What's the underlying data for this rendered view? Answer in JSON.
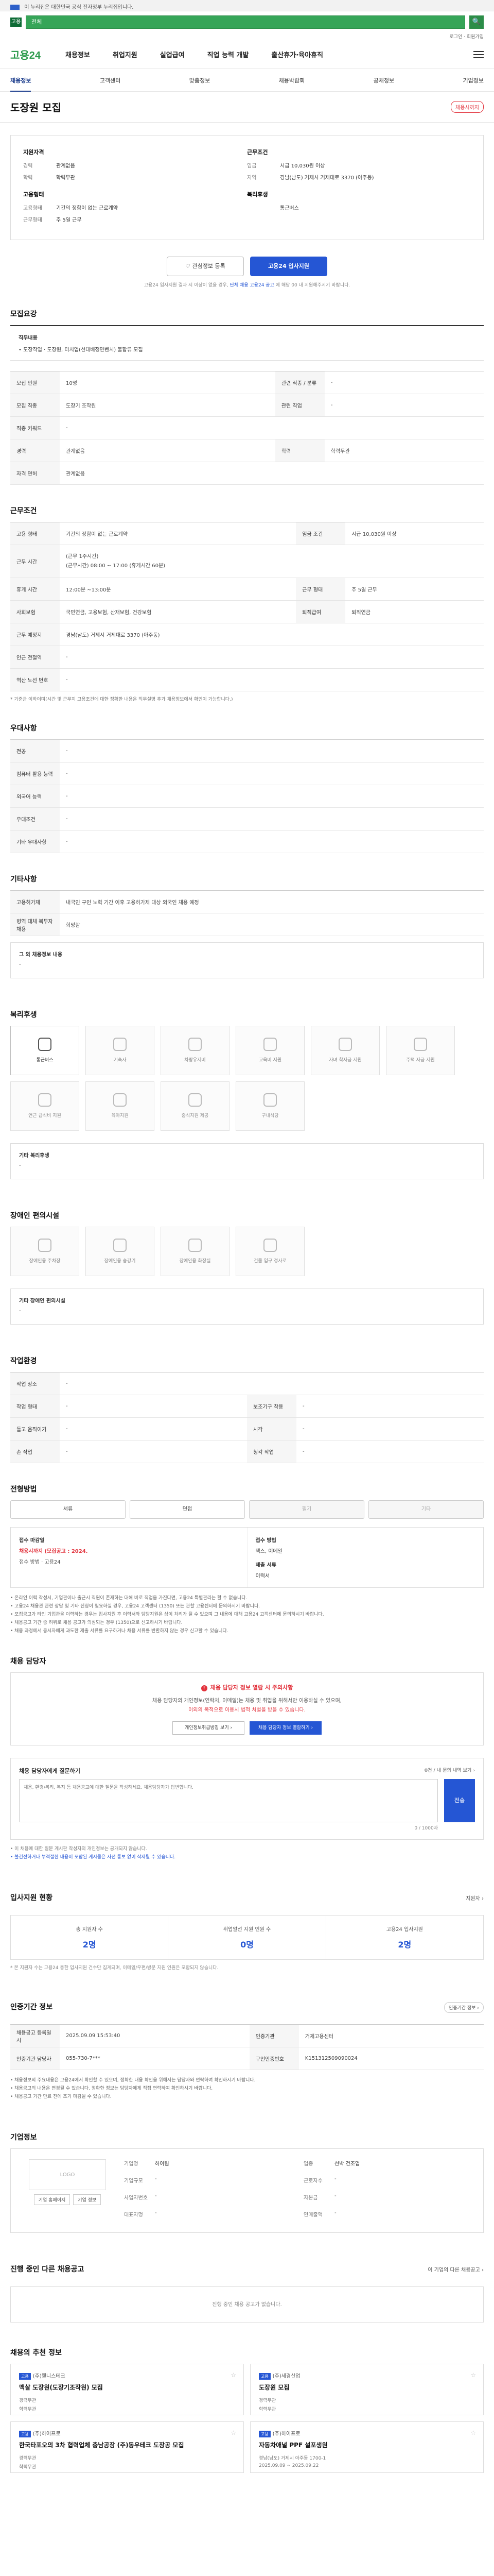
{
  "gov_bar": {
    "text": "이 누리집은 대한민국 공식 전자정부 누리집입니다."
  },
  "search": {
    "badge": "고용",
    "value": "전체",
    "button": "🔍"
  },
  "util_links": "로그인 · 회원가입",
  "header": {
    "logo": "고용24",
    "nav": [
      "채용정보",
      "취업지원",
      "실업급여",
      "직업 능력 개발",
      "출산휴가·육아휴직"
    ]
  },
  "subnav": {
    "items": [
      "채용정보",
      "고객센터",
      "맞춤정보",
      "채용박람회",
      "공채정보",
      "기업정보"
    ],
    "active": 0
  },
  "title": {
    "text": "도장원 모집",
    "status": "채용시까지"
  },
  "summary": {
    "left": {
      "h1": "지원자격",
      "rows": [
        {
          "k": "경력",
          "v": "관계없음"
        },
        {
          "k": "학력",
          "v": "학력무관"
        }
      ],
      "h2": "고용형태",
      "rows2": [
        {
          "k": "고용형태",
          "v": "기간의 정함이 없는 근로계약"
        },
        {
          "k": "근무형태",
          "v": "주 5일 근무"
        }
      ]
    },
    "right": {
      "h1": "근무조건",
      "rows": [
        {
          "k": "임금",
          "v": "시급 10,030원 이상"
        },
        {
          "k": "지역",
          "v": "경남(남도) 거제시 거제대로 3370 (아주동)"
        }
      ],
      "h2": "복리후생",
      "rows2": [
        {
          "k": "",
          "v": "통근버스"
        }
      ]
    },
    "btn_save": "♡ 관심정보 등록",
    "btn_apply": "고용24 입사지원",
    "note_a": "고용24 입사지원 결과 시 이상이 없을 경우,",
    "note_link": "단체 채용 고용24 공고",
    "note_b": "에 해당 00 내 지원해주시기 바랍니다."
  },
  "job_desc": {
    "title": "모집요강",
    "label": "직무내용",
    "text": "• 도장작업 · 도장원, 터치업(선대배정면벤치) 불합류 모집",
    "rows": [
      {
        "k": "모집 인원",
        "v": "10명",
        "k2": "관련 직종 / 분류",
        "v2": "-"
      },
      {
        "k": "모집 직종",
        "v": "도장기 조작원",
        "k2": "관련 직업",
        "v2": "-"
      },
      {
        "k": "직종 키워드",
        "v": "-",
        "k2": "",
        "v2": ""
      },
      {
        "k": "경력",
        "v": "관계없음",
        "k2": "학력",
        "v2": "학력무관"
      },
      {
        "k": "자격 면허",
        "v": "관계없음",
        "k2": "",
        "v2": ""
      }
    ]
  },
  "conditions": {
    "title": "근무조건",
    "rows": [
      {
        "k": "고용 형태",
        "v": "기간의 정함이 없는 근로계약",
        "k2": "임금 조건",
        "v2": "시급 10,030원 이상"
      },
      {
        "k": "근무 시간",
        "v": "(근무 1주시간)\n(근무시간) 08:00 ~ 17:00 (휴게시간 60분)",
        "k2": "",
        "v2": ""
      },
      {
        "k": "휴게 시간",
        "v": "12:00분 ~13:00분",
        "k2": "근무 형태",
        "v2": "주 5일 근무"
      },
      {
        "k": "사회보험",
        "v": "국민연금, 고용보험, 산재보험, 건강보험",
        "k2": "퇴직급여",
        "v2": "퇴직연금"
      },
      {
        "k": "근무 예정지",
        "v": "경남(남도) 거제시 거제대로 3370 (아주동)",
        "k2": "",
        "v2": ""
      },
      {
        "k": "인근 전철역",
        "v": "-",
        "k2": "",
        "v2": ""
      },
      {
        "k": "역산 노선 번호",
        "v": "-",
        "k2": "",
        "v2": ""
      }
    ],
    "footnote": "* 기준금 이하이며(시간 및 근무지 고용조건에 대한 정확한 내용은 직무설명 추가 채용정보에서 확인이 가능합니다.)"
  },
  "preference": {
    "title": "우대사항",
    "rows": [
      {
        "k": "전공",
        "v": "-"
      },
      {
        "k": "컴퓨터 활용 능력",
        "v": "-"
      },
      {
        "k": "외국어 능력",
        "v": "-"
      },
      {
        "k": "우대조건",
        "v": "-"
      },
      {
        "k": "기타 우대사항",
        "v": "-"
      }
    ]
  },
  "other": {
    "title": "기타사항",
    "rows": [
      {
        "k": "고용허가제",
        "v": "내국인 구인 노력 기간 이후 고용허가제 대상 외국인 채용 예정"
      },
      {
        "k": "병역 대체 복무자 채용",
        "v": "희망함"
      }
    ],
    "box_title": "그 외 채용정보 내용",
    "box_text": "-"
  },
  "welfare": {
    "title": "복리후생",
    "cards": [
      {
        "label": "통근버스",
        "on": true
      },
      {
        "label": "기숙사",
        "on": false
      },
      {
        "label": "차량유지비",
        "on": false
      },
      {
        "label": "교육비 지원",
        "on": false
      },
      {
        "label": "자녀 학자금 지원",
        "on": false
      },
      {
        "label": "주택 자금 지원",
        "on": false
      },
      {
        "label": "연근 급식비 지원",
        "on": false
      },
      {
        "label": "육아지원",
        "on": false
      },
      {
        "label": "중식지원 제공",
        "on": false
      },
      {
        "label": "구내식당",
        "on": false
      }
    ],
    "box_title": "기타 복리후생",
    "box_text": "-"
  },
  "disability": {
    "title": "장애인 편의시설",
    "cards": [
      {
        "label": "장애인용 주차장"
      },
      {
        "label": "장애인용 승강기"
      },
      {
        "label": "장애인용 화장실"
      },
      {
        "label": "건물 입구 경사로"
      }
    ],
    "box_title": "기타 장애인 편의시설",
    "box_text": "-"
  },
  "environment": {
    "title": "작업환경",
    "rows": [
      {
        "k": "작업 장소",
        "v": "-",
        "k2": "",
        "v2": ""
      },
      {
        "k": "작업 형태",
        "v": "-",
        "k2": "보조기구 착용",
        "v2": "-"
      },
      {
        "k": "들고 움직이기",
        "v": "-",
        "k2": "시각",
        "v2": "-"
      },
      {
        "k": "손 작업",
        "v": "-",
        "k2": "청각 작업",
        "v2": "-"
      }
    ]
  },
  "method": {
    "title": "전형방법",
    "steps": [
      {
        "label": "서류",
        "dim": false
      },
      {
        "label": "면접",
        "dim": false
      },
      {
        "label": "필기",
        "dim": true
      },
      {
        "label": "기타",
        "dim": true
      }
    ],
    "c1_lbl": "접수 마감일",
    "c1_val": "채용시까지 (모집공고 : 2024.",
    "c1_val2": "접수 방법 · 고용24",
    "c2_lbl": "접수 방법",
    "c2_val": "택스, 이메일",
    "c3_lbl": "제출 서류",
    "c3_val": "이력서",
    "warns": [
      "• 온라인 이력 작성시, 기업관이나 출근시 직원이 존재하는 대해 바로 직업을 가진다면, 고용24 특별관리는 할 수 없습니다.",
      "• 고용24 채용관 관련 상담 및 기타 신청이 필요하실 경우, 고용24 고객센터 (1350) 또는 관할 고용센터에 문의하시기 바랍니다.",
      "• 모집공고가 타인 기업관을 이력하는 경우는 입사지원 후 이력서와 담당지원은 상이 처리가 될 수 있으며 그 내용에 대해 고용24 고객센터에 문의하시기 바랍니다.",
      "• 채용공고 기간 중 허위로 채용 공고가 의심되는 경우 (1350)으로 신고하시기 바랍니다.",
      "• 채용 과정에서 응시자에게 과도한 제출 서류를 요구하거나 채용 서류를 반환하지 않는 경우 신고할 수 있습니다."
    ]
  },
  "contact": {
    "title": "채용 담당자",
    "alert_head": "채용 담당자 정보 열람 시 주의사항",
    "alert_l1": "채용 담당자의 개인정보(연락처, 이메일)는 채용 및 취업을 위해서만 이용하실 수 있으며,",
    "alert_l2": "이외의 목적으로 이용시 법적 처벌을 받을 수 있습니다.",
    "btn1": "개인정보취급방침 보기 ›",
    "btn2": "채용 담당자 정보 열람하기 ›",
    "inq_title": "채용 담당자에게 질문하기",
    "inq_meta": "0건 / 내 문의 내역 보기 ›",
    "inq_placeholder": "채용, 환경/복리, 복지 등 채용공고에 대한 질문을 작성하세요. 채용담당자가 답변합니다.",
    "send": "전송",
    "counter": "0 / 1000자",
    "inq_note1": "• 이 채용에 대한 질문 게시판 작성자의 개인정보는 공개되지 않습니다.",
    "inq_note2": "• 불건전하거나 부적절한 내용이 포함된 게시물은 사전 통보 없이 삭제될 수 있습니다."
  },
  "stats": {
    "title": "입사지원 현황",
    "more": "지원자 ›",
    "items": [
      {
        "label": "총 지원자 수",
        "value": "2명"
      },
      {
        "label": "취업알선 지원 인원 수",
        "value": "0명"
      },
      {
        "label": "고용24 입사지원",
        "value": "2명"
      }
    ],
    "note": "* 본 지원자 수는 고용24 통한 입사지원 건수만 집계되며, 이메일/우편/방문 지원 인원은 포함되지 않습니다."
  },
  "info": {
    "title": "인증기간 정보",
    "right": "인증기간 정보 ›",
    "rows": [
      {
        "k": "채용공고 등록일시",
        "v": "2025.09.09 15:53:40",
        "k2": "인증기관",
        "v2": "거제고용센터"
      },
      {
        "k": "인증기관 담당자",
        "v": "055-730-7***",
        "k2": "구인인증번호",
        "v2": "K151312509090024"
      }
    ],
    "notes": [
      "• 채용정보의 주요내용은 고용24에서 확인할 수 있으며, 정확한 내용 확인을 위해서는 담당자와 연락하여 확인하시기 바랍니다.",
      "• 채용공고의 내용은 변경될 수 있습니다. 정확한 정보는 담당자에게 직접 연락하여 확인하시기 바랍니다.",
      "• 채용공고 기간 만료 전에 조기 마감될 수 있습니다."
    ]
  },
  "company": {
    "title": "기업정보",
    "logo_text": "LOGO",
    "btn1": "기업 홈페이지",
    "btn2": "기업 정보",
    "rows": [
      {
        "k": "기업명",
        "v": "하이팀"
      },
      {
        "k": "업종",
        "v": "선박 건조업"
      },
      {
        "k": "기업규모",
        "v": "-"
      },
      {
        "k": "근로자수",
        "v": "-"
      },
      {
        "k": "사업자번호",
        "v": "-"
      },
      {
        "k": "자본금",
        "v": "-"
      },
      {
        "k": "대표자명",
        "v": "-"
      },
      {
        "k": "연매출액",
        "v": "-"
      }
    ]
  },
  "other_jobs": {
    "title": "진행 중인 다른 채용공고",
    "more": "이 기업의 다른 채용공고 ›",
    "empty": "진행 중인 채용 공고가 없습니다."
  },
  "recommend": {
    "title": "채용의 추천 정보",
    "items": [
      {
        "tag": "고용",
        "company": "(주)웰니스테크",
        "title": "맥살 도장원(도장기조작원) 모집",
        "m1": "경력무관",
        "m2": "학력무관"
      },
      {
        "tag": "고용",
        "company": "(주)세경산업",
        "title": "도장원 모집",
        "m1": "경력무관",
        "m2": "학력무관"
      },
      {
        "tag": "고용",
        "company": "(주)하이프로",
        "title": "한국타포오의 3차 협력업체 충남공장 (주)동우테크 도장공 모집",
        "m1": "경력무관",
        "m2": "학력무관"
      },
      {
        "tag": "고용",
        "company": "(주)하이프로",
        "title": "자동차애널 PPF 설포생원",
        "m1": "경남(남도) 거제시 아주동 1700-1",
        "m2": "2025.09.09 ~ 2025.09.22"
      }
    ]
  }
}
